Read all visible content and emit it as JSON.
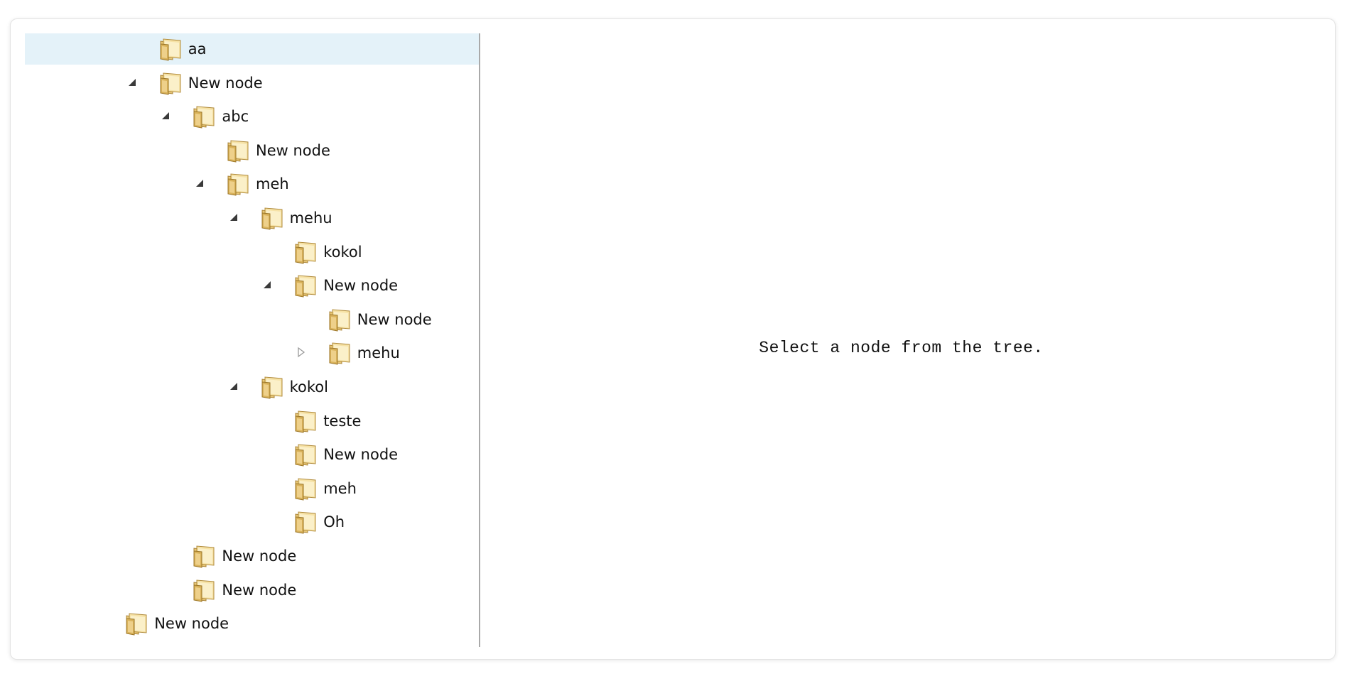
{
  "tree": {
    "nodes": [
      {
        "label": "aa",
        "depth": 3,
        "expander": "none",
        "selected": true
      },
      {
        "label": "New node",
        "depth": 3,
        "expander": "expanded",
        "selected": false
      },
      {
        "label": "abc",
        "depth": 4,
        "expander": "expanded",
        "selected": false
      },
      {
        "label": "New node",
        "depth": 5,
        "expander": "none",
        "selected": false
      },
      {
        "label": "meh",
        "depth": 5,
        "expander": "expanded",
        "selected": false
      },
      {
        "label": "mehu",
        "depth": 6,
        "expander": "expanded",
        "selected": false
      },
      {
        "label": "kokol",
        "depth": 7,
        "expander": "none",
        "selected": false
      },
      {
        "label": "New node",
        "depth": 7,
        "expander": "expanded",
        "selected": false
      },
      {
        "label": "New node",
        "depth": 8,
        "expander": "none",
        "selected": false
      },
      {
        "label": "mehu",
        "depth": 8,
        "expander": "collapsed",
        "selected": false
      },
      {
        "label": "kokol",
        "depth": 6,
        "expander": "expanded",
        "selected": false
      },
      {
        "label": "teste",
        "depth": 7,
        "expander": "none",
        "selected": false
      },
      {
        "label": "New node",
        "depth": 7,
        "expander": "none",
        "selected": false
      },
      {
        "label": "meh",
        "depth": 7,
        "expander": "none",
        "selected": false
      },
      {
        "label": "Oh",
        "depth": 7,
        "expander": "none",
        "selected": false
      },
      {
        "label": "New node",
        "depth": 4,
        "expander": "none",
        "selected": false
      },
      {
        "label": "New node",
        "depth": 4,
        "expander": "none",
        "selected": false
      },
      {
        "label": "New node",
        "depth": 2,
        "expander": "none",
        "selected": false
      }
    ]
  },
  "detail": {
    "placeholder": "Select a node from the tree."
  },
  "colors": {
    "selection_bg": "#e4f2f9",
    "divider": "#a9a9a9",
    "folder_fill": "#f1d68c",
    "folder_edge": "#b08a3a"
  },
  "icons": {
    "expanded": "expanded-triangle-icon",
    "collapsed": "collapsed-triangle-icon",
    "folder": "folder-icon"
  }
}
